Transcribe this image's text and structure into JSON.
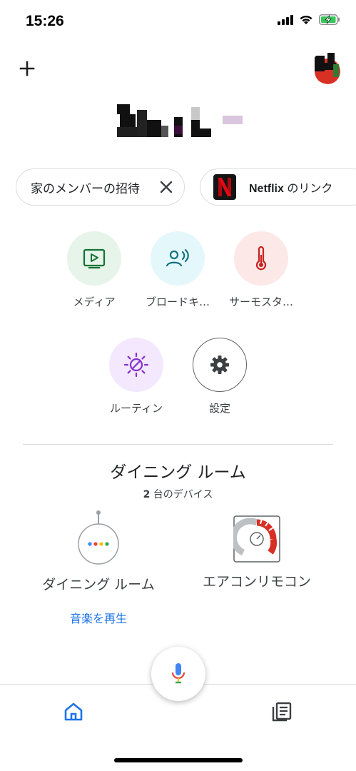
{
  "status_bar": {
    "time": "15:26",
    "icons": [
      "signal-icon",
      "wifi-icon",
      "battery-charging-icon"
    ]
  },
  "header": {
    "add_icon": "plus-icon",
    "avatar_icon": "avatar"
  },
  "chips": {
    "invite": {
      "label": "家のメンバーの招待",
      "close_icon": "close-icon"
    },
    "netflix": {
      "brand": "Netflix",
      "label": " のリンク",
      "logo_letter": "N"
    }
  },
  "tiles": [
    {
      "id": "media",
      "label": "メディア",
      "icon": "play-icon",
      "bg": "#e6f4ea",
      "fg": "#137333"
    },
    {
      "id": "broadcast",
      "label": "ブロードキ…",
      "icon": "broadcast-icon",
      "bg": "#e4f7fb",
      "fg": "#12737f"
    },
    {
      "id": "thermostat",
      "label": "サーモスタ…",
      "icon": "thermometer-icon",
      "bg": "#fce8e6",
      "fg": "#c5221f"
    },
    {
      "id": "routine",
      "label": "ルーティン",
      "icon": "routine-icon",
      "bg": "#f3e8fd",
      "fg": "#8430ce"
    },
    {
      "id": "settings",
      "label": "設定",
      "icon": "gear-icon",
      "bg": "#ffffff",
      "fg": "#3c4043"
    }
  ],
  "room": {
    "title": "ダイニング ルーム",
    "count_number": "2",
    "count_suffix": " 台のデバイス"
  },
  "devices": [
    {
      "id": "speaker",
      "label": "ダイニング ルーム",
      "action": "音楽を再生",
      "icon": "smart-speaker-icon"
    },
    {
      "id": "ac",
      "label": "エアコンリモコン",
      "icon": "ac-remote-icon"
    }
  ],
  "bottom_nav": {
    "home_icon": "home-icon",
    "mic_icon": "mic-icon",
    "feed_icon": "feed-icon"
  },
  "colors": {
    "accent_blue": "#1a73e8",
    "google_blue": "#4285f4",
    "google_red": "#ea4335",
    "google_yellow": "#fbbc04",
    "google_green": "#34a853",
    "battery_green": "#34c759"
  }
}
